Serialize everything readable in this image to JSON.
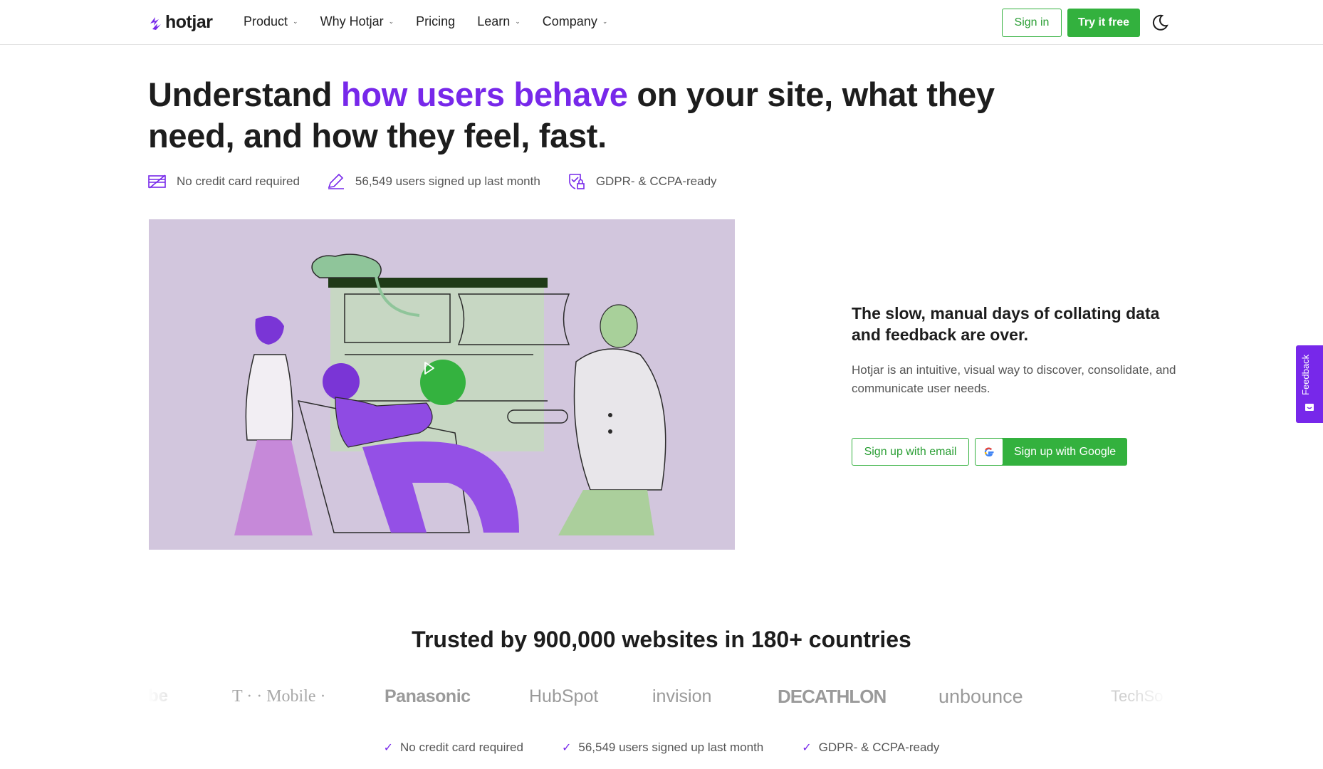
{
  "nav": {
    "logo_text": "hotjar",
    "items": [
      {
        "label": "Product",
        "has_dropdown": true
      },
      {
        "label": "Why Hotjar",
        "has_dropdown": true
      },
      {
        "label": "Pricing",
        "has_dropdown": false
      },
      {
        "label": "Learn",
        "has_dropdown": true
      },
      {
        "label": "Company",
        "has_dropdown": true
      }
    ],
    "sign_in": "Sign in",
    "try_free": "Try it free",
    "theme_icon": "moon-icon"
  },
  "hero": {
    "title_before": "Understand ",
    "title_accent": "how users behave",
    "title_after": " on your site, what they need, and how they feel, fast.",
    "badges": [
      {
        "icon": "credit-card-icon",
        "text": "No credit card required"
      },
      {
        "icon": "pencil-icon",
        "text": "56,549 users signed up last month"
      },
      {
        "icon": "shield-lock-icon",
        "text": "GDPR- & CCPA-ready"
      }
    ]
  },
  "video": {
    "play_icon": "play-icon"
  },
  "pitch": {
    "title": "The slow, manual days of collating data and feedback are over.",
    "description": "Hotjar is an intuitive, visual way to discover, consolidate, and communicate user needs.",
    "signup_email": "Sign up with email",
    "signup_google": "Sign up with Google"
  },
  "feedback_tab": {
    "label": "Feedback"
  },
  "trusted": {
    "title": "Trusted by 900,000 websites in 180+ countries",
    "logos": [
      "be",
      "T · · Mobile ·",
      "Panasonic",
      "HubSpot",
      "invision",
      "DECATHLON",
      "unbounce",
      "TechSo"
    ]
  },
  "footer_checks": [
    "No credit card required",
    "56,549 users signed up last month",
    "GDPR- & CCPA-ready"
  ],
  "colors": {
    "accent_purple": "#7728ea",
    "brand_green": "#33b13e",
    "video_bg": "#d2c6dd"
  }
}
